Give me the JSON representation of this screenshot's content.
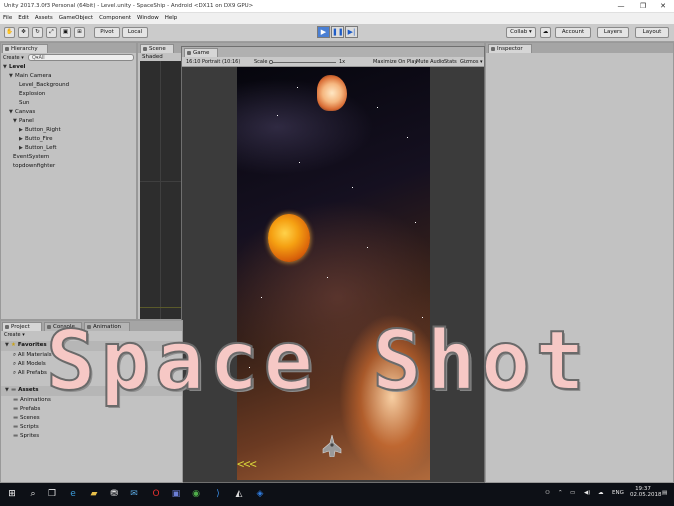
{
  "window": {
    "title": "Unity 2017.3.0f3 Personal (64bit) - Level.unity - SpaceShip - Android <DX11 on DX9 GPU>",
    "controls": [
      "—",
      "❐",
      "✕"
    ]
  },
  "menu": [
    "File",
    "Edit",
    "Assets",
    "GameObject",
    "Component",
    "Window",
    "Help"
  ],
  "toolbar": {
    "pivot": "Pivot",
    "local": "Local",
    "collab": "Collab ▾",
    "account": "Account",
    "layers": "Layers",
    "layout": "Layout"
  },
  "hierarchy": {
    "tab": "Hierarchy",
    "create": "Create ▾",
    "search_placeholder": "Q▾All",
    "items": [
      {
        "label": "Level",
        "bold": true
      },
      {
        "label": "Main Camera"
      },
      {
        "label": "Level_Background"
      },
      {
        "label": "Explosion"
      },
      {
        "label": "Sun"
      },
      {
        "label": "Canvas"
      },
      {
        "label": "Panel"
      },
      {
        "label": "Button_Right"
      },
      {
        "label": "Butto_Fire"
      },
      {
        "label": "Button_Left"
      },
      {
        "label": "EventSystem"
      },
      {
        "label": "topdownfighter"
      }
    ]
  },
  "scene": {
    "tab": "Scene",
    "shading": "Shaded"
  },
  "game": {
    "tab": "Game",
    "aspect": "16:10 Portrait (10:16)",
    "scale_label": "Scale",
    "scale_value": "1x",
    "maximize": "Maximize On Play",
    "mute": "Mute Audio",
    "stats": "Stats",
    "gizmos": "Gizmos ▾",
    "left_button": "<<<"
  },
  "inspector": {
    "tab": "Inspector"
  },
  "project": {
    "tabs": [
      "Project",
      "Console",
      "Animation"
    ],
    "create": "Create ▾",
    "favorites": "Favorites",
    "favorites_items": [
      "All Materials",
      "All Models",
      "All Prefabs"
    ],
    "assets": "Assets",
    "assets_items": [
      "Animations",
      "Prefabs",
      "Scenes",
      "Scripts",
      "Sprites"
    ]
  },
  "overlay_title": "Space Shot",
  "taskbar": {
    "lang": "ENG",
    "time": "19:37",
    "date": "02.05.2018"
  }
}
